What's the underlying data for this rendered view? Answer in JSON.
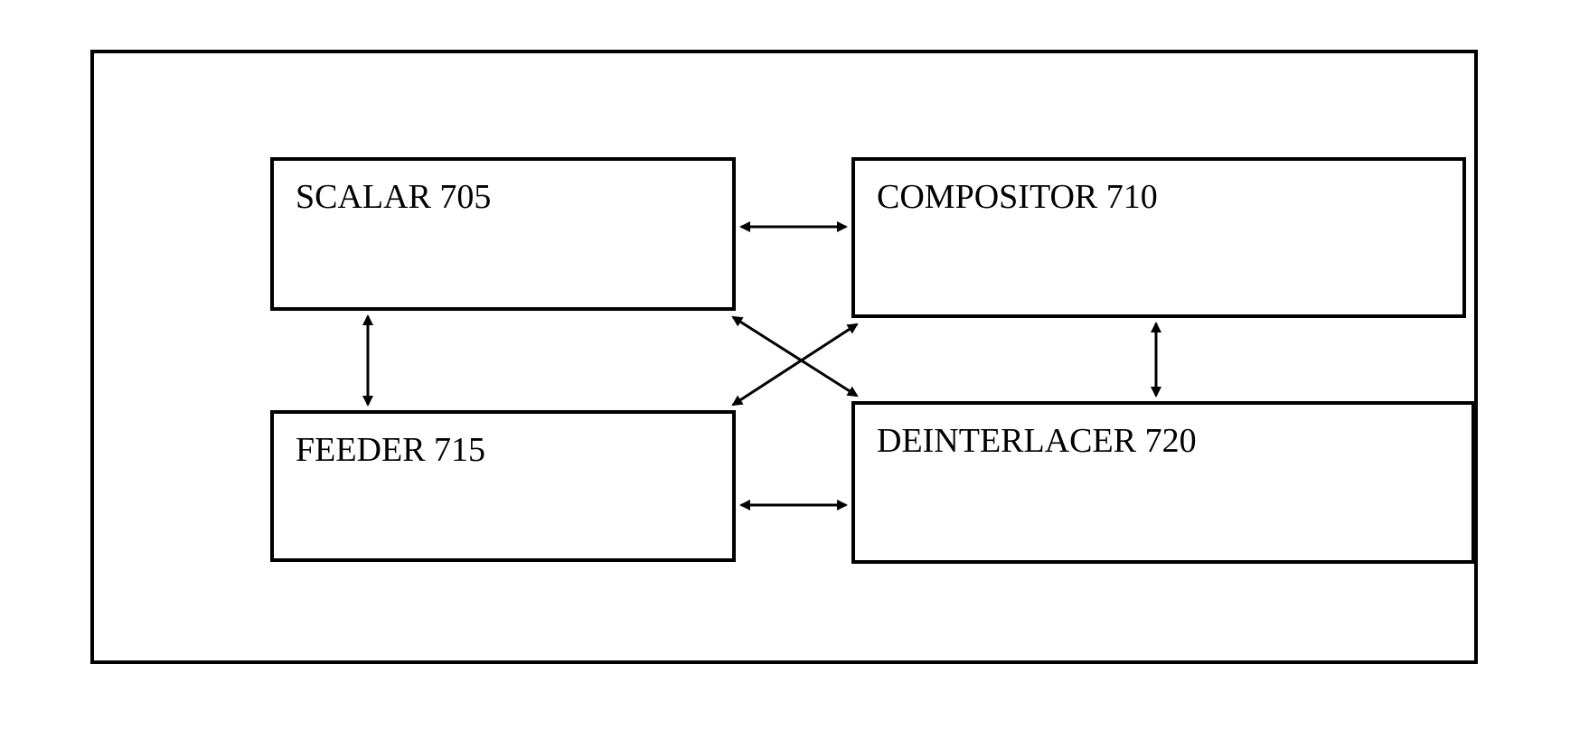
{
  "blocks": {
    "scalar": "SCALAR 705",
    "compositor": "COMPOSITOR 710",
    "feeder": "FEEDER 715",
    "deinterlacer": "DEINTERLACER 720"
  }
}
